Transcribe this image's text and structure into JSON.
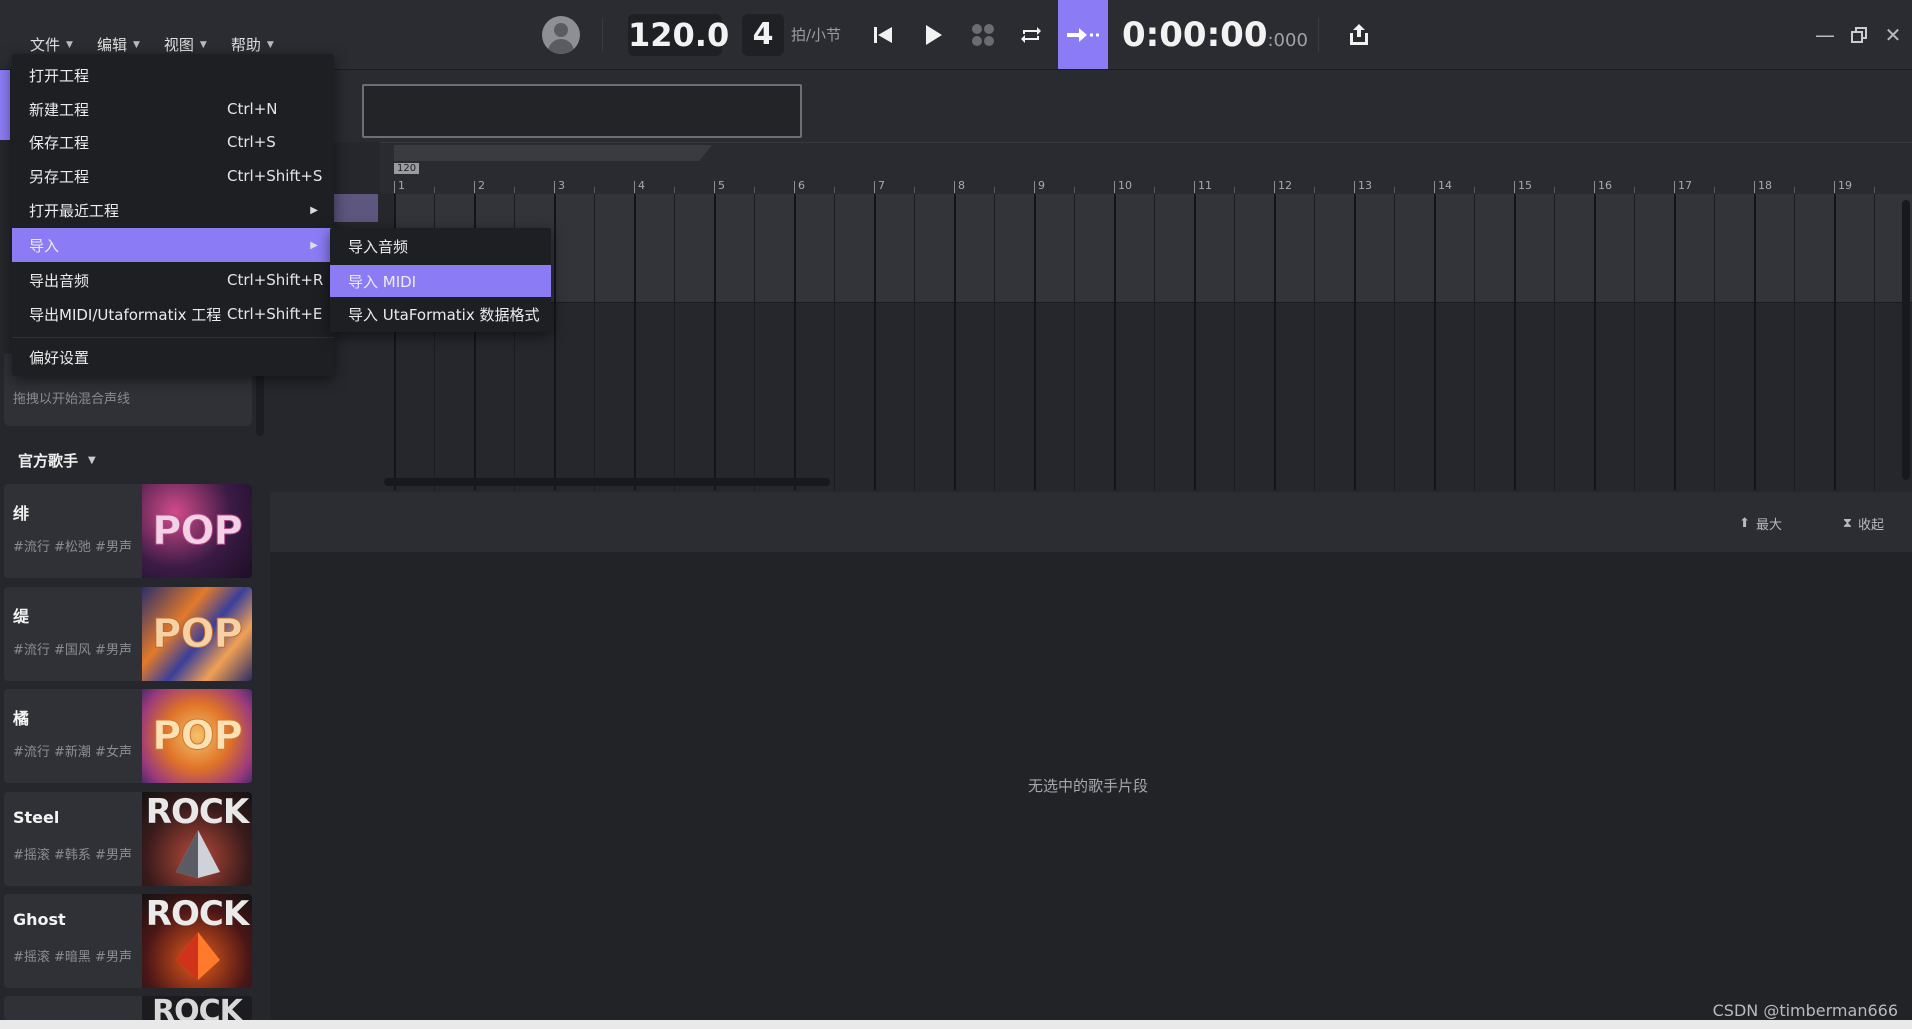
{
  "menubar": [
    {
      "label": "文件"
    },
    {
      "label": "编辑"
    },
    {
      "label": "视图"
    },
    {
      "label": "帮助"
    }
  ],
  "transport": {
    "tempo": "120.0",
    "beats": "4",
    "beats_label": "拍/小节",
    "time_main": "0:00:00",
    "time_ms": ":000",
    "accent": "#8b7cf6"
  },
  "file_menu": {
    "items": [
      {
        "label": "打开工程",
        "shortcut": ""
      },
      {
        "label": "新建工程",
        "shortcut": "Ctrl+N"
      },
      {
        "label": "保存工程",
        "shortcut": "Ctrl+S"
      },
      {
        "label": "另存工程",
        "shortcut": "Ctrl+Shift+S"
      },
      {
        "label": "打开最近工程",
        "shortcut": ""
      },
      {
        "label": "导入",
        "shortcut": ""
      },
      {
        "label": "导出音频",
        "shortcut": "Ctrl+Shift+R"
      },
      {
        "label": "导出MIDI/Utaformatix 工程",
        "shortcut": "Ctrl+Shift+E"
      },
      {
        "label": "偏好设置",
        "shortcut": ""
      }
    ],
    "highlighted": "导入"
  },
  "import_submenu": {
    "items": [
      {
        "label": "导入音频"
      },
      {
        "label": "导入 MIDI"
      },
      {
        "label": "导入 UtaFormatix 数据格式"
      }
    ],
    "highlighted": "导入 MIDI"
  },
  "left_panel": {
    "mix_hint": "拖拽以开始混合声线",
    "section_title": "官方歌手",
    "singers": [
      {
        "name": "绯",
        "tags": "#流行 #松弛 #男声",
        "cover": "POP"
      },
      {
        "name": "缇",
        "tags": "#流行 #国风 #男声",
        "cover": "POP"
      },
      {
        "name": "橘",
        "tags": "#流行 #新潮 #女声",
        "cover": "POP"
      },
      {
        "name": "Steel",
        "tags": "#摇滚 #韩系 #男声",
        "cover": "ROCK"
      },
      {
        "name": "Ghost",
        "tags": "#摇滚 #暗黑 #男声",
        "cover": "ROCK"
      },
      {
        "name": "",
        "tags": "",
        "cover": "ROCK"
      }
    ]
  },
  "ruler": {
    "tempo_marker": "120",
    "bars": [
      "1",
      "2",
      "3",
      "4",
      "5",
      "6",
      "7",
      "8",
      "9",
      "10",
      "11",
      "12",
      "13",
      "14",
      "15",
      "16",
      "17",
      "18",
      "19"
    ]
  },
  "bottom_panel": {
    "max_label": "最大",
    "collapse_label": "收起",
    "empty_message": "无选中的歌手片段"
  },
  "watermark": "CSDN @timberman666"
}
